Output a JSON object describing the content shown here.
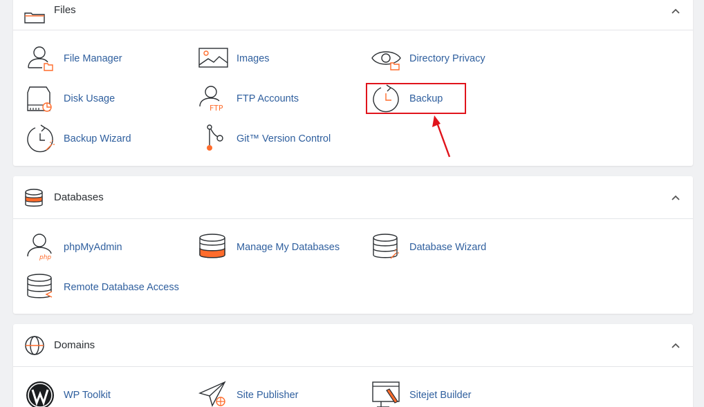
{
  "colors": {
    "accent_orange": "#ff6c2c",
    "link_blue": "#2f5f9e",
    "icon_stroke": "#2b2f33",
    "highlight_red": "#e0131b"
  },
  "files": {
    "title": "Files",
    "icon": "folder-icon",
    "items": [
      {
        "label": "File Manager",
        "icon": "file-manager-icon"
      },
      {
        "label": "Images",
        "icon": "image-icon"
      },
      {
        "label": "Directory Privacy",
        "icon": "eye-icon"
      },
      {
        "label": "Disk Usage",
        "icon": "disk-usage-icon"
      },
      {
        "label": "FTP Accounts",
        "icon": "ftp-user-icon"
      },
      {
        "label": "Backup",
        "icon": "backup-clock-icon"
      },
      {
        "label": "Backup Wizard",
        "icon": "backup-wizard-icon"
      },
      {
        "label": "Git™ Version Control",
        "icon": "git-branch-icon"
      }
    ]
  },
  "databases": {
    "title": "Databases",
    "icon": "database-icon",
    "items": [
      {
        "label": "phpMyAdmin",
        "icon": "phpmyadmin-icon"
      },
      {
        "label": "Manage My Databases",
        "icon": "manage-databases-icon"
      },
      {
        "label": "Database Wizard",
        "icon": "database-wizard-icon"
      },
      {
        "label": "Remote Database Access",
        "icon": "remote-database-icon"
      }
    ]
  },
  "domains": {
    "title": "Domains",
    "icon": "globe-icon",
    "items": [
      {
        "label": "WP Toolkit",
        "icon": "wordpress-icon"
      },
      {
        "label": "Site Publisher",
        "icon": "paper-plane-icon"
      },
      {
        "label": "Sitejet Builder",
        "icon": "sitejet-builder-icon"
      }
    ]
  }
}
